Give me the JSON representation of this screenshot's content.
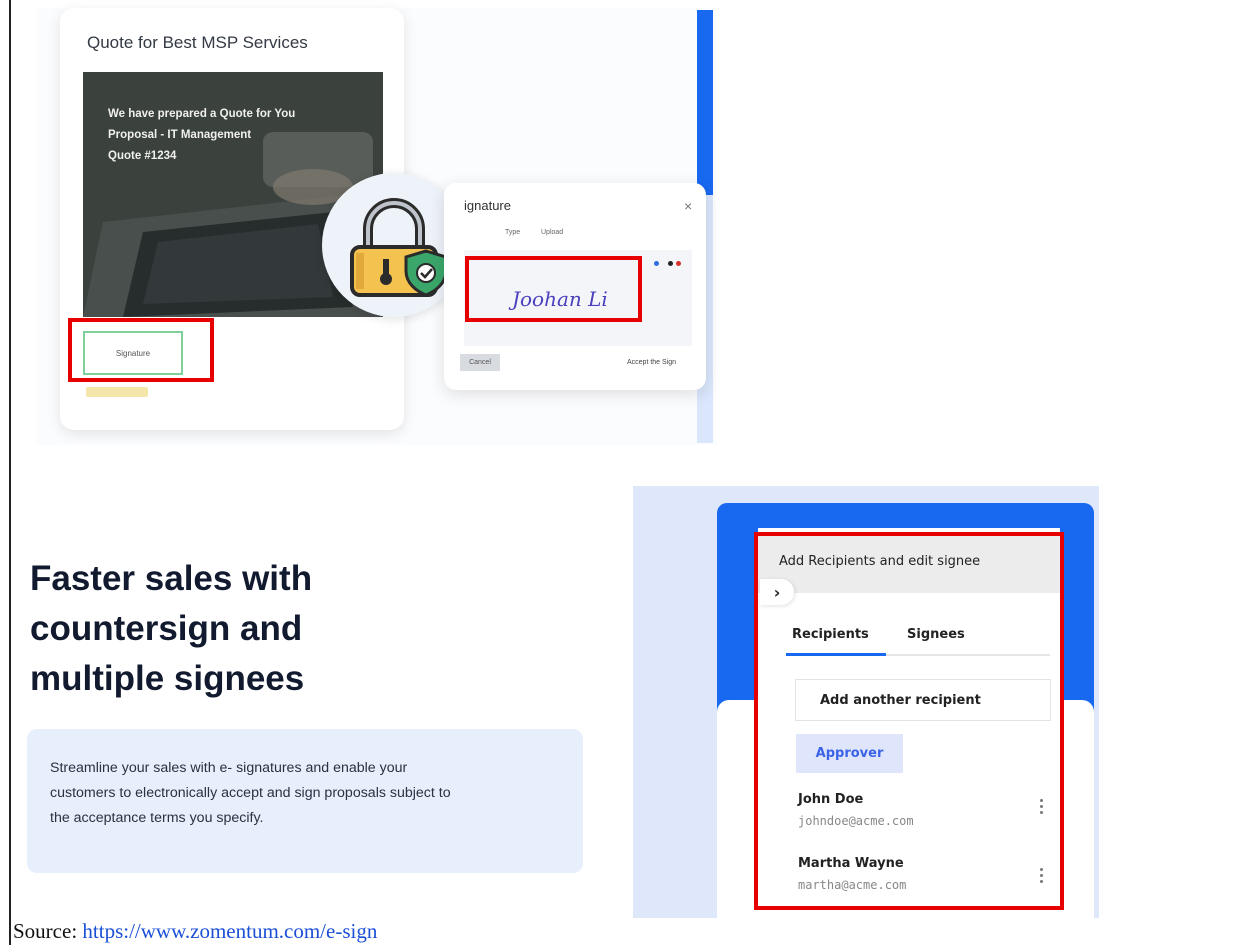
{
  "quote_preview": {
    "title": "Quote for Best MSP Services",
    "photo_lines": [
      "We have prepared a Quote for You",
      "Proposal - IT Management",
      "Quote #1234"
    ],
    "signature_field_label": "Signature"
  },
  "signature_dialog": {
    "title": "ignature",
    "close_glyph": "×",
    "tabs": [
      "Type",
      "Upload"
    ],
    "signature_text": "Joohan Li",
    "ink_colors": [
      "#2d6fe0",
      "#222222",
      "#d9302c"
    ],
    "cancel_label": "Cancel",
    "accept_label": "Accept the Sign"
  },
  "hero": {
    "heading_lines": [
      "Faster sales with",
      "countersign and",
      "multiple signees"
    ],
    "description_lines": [
      "Streamline your sales with e- signatures and enable your",
      "customers to electronically accept and sign proposals subject to",
      "the acceptance terms you specify."
    ]
  },
  "recipients_drawer": {
    "title": "Add Recipients and edit signee",
    "collapse_glyph": "›",
    "tabs": [
      {
        "label": "Recipients",
        "active": true
      },
      {
        "label": "Signees",
        "active": false
      }
    ],
    "add_recipient_label": "Add another recipient",
    "role_badge": "Approver",
    "people": [
      {
        "name": "John Doe",
        "email": "johndoe@acme.com"
      },
      {
        "name": "Martha Wayne",
        "email": "martha@acme.com"
      }
    ]
  },
  "source": {
    "prefix": "Source: ",
    "url": "https://www.zomentum.com/e-sign"
  },
  "colors": {
    "brand_blue": "#1968f0",
    "highlight_red": "#e60000",
    "description_bg": "#e7eefc"
  }
}
